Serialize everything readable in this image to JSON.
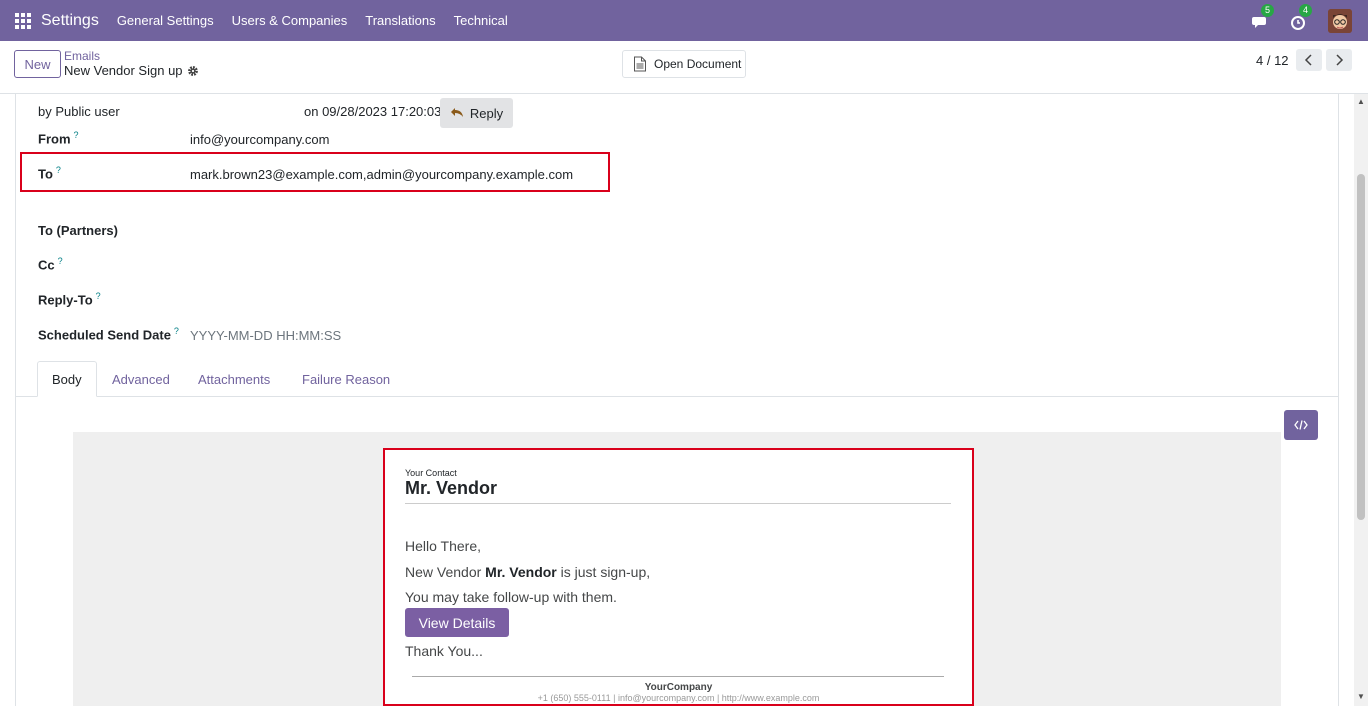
{
  "navbar": {
    "brand": "Settings",
    "menu": [
      "General Settings",
      "Users & Companies",
      "Translations",
      "Technical"
    ],
    "messages_count": "5",
    "activities_count": "4"
  },
  "control_panel": {
    "new_label": "New",
    "breadcrumb_parent": "Emails",
    "breadcrumb_current": "New Vendor Sign up",
    "open_document_label": "Open Document",
    "pager": "4 / 12"
  },
  "message": {
    "by": "by  Public user",
    "date": "on 09/28/2023 17:20:03",
    "reply_label": "Reply"
  },
  "fields": {
    "from_label": "From",
    "from_value": "info@yourcompany.com",
    "to_label": "To",
    "to_value": "mark.brown23@example.com,admin@yourcompany.example.com",
    "to_partners_label": "To (Partners)",
    "cc_label": "Cc",
    "reply_to_label": "Reply-To",
    "scheduled_label": "Scheduled Send Date",
    "scheduled_placeholder": "YYYY-MM-DD HH:MM:SS",
    "help_marker": "?"
  },
  "tabs": [
    "Body",
    "Advanced",
    "Attachments",
    "Failure Reason"
  ],
  "email": {
    "contact_caption": "Your Contact",
    "contact_name": "Mr. Vendor",
    "greeting": "Hello There,",
    "line1_prefix": "New Vendor ",
    "line1_name": "Mr. Vendor",
    "line1_suffix": " is just sign-up,",
    "line2": "You may take follow-up with them.",
    "button_label": "View Details",
    "closing": "Thank You...",
    "company": "YourCompany",
    "footer_contact": "+1 (650) 555-0111 | info@yourcompany.com | http://www.example.com"
  },
  "colors": {
    "brand": "#71639e",
    "highlight": "#d9001b",
    "badge": "#28a745"
  }
}
